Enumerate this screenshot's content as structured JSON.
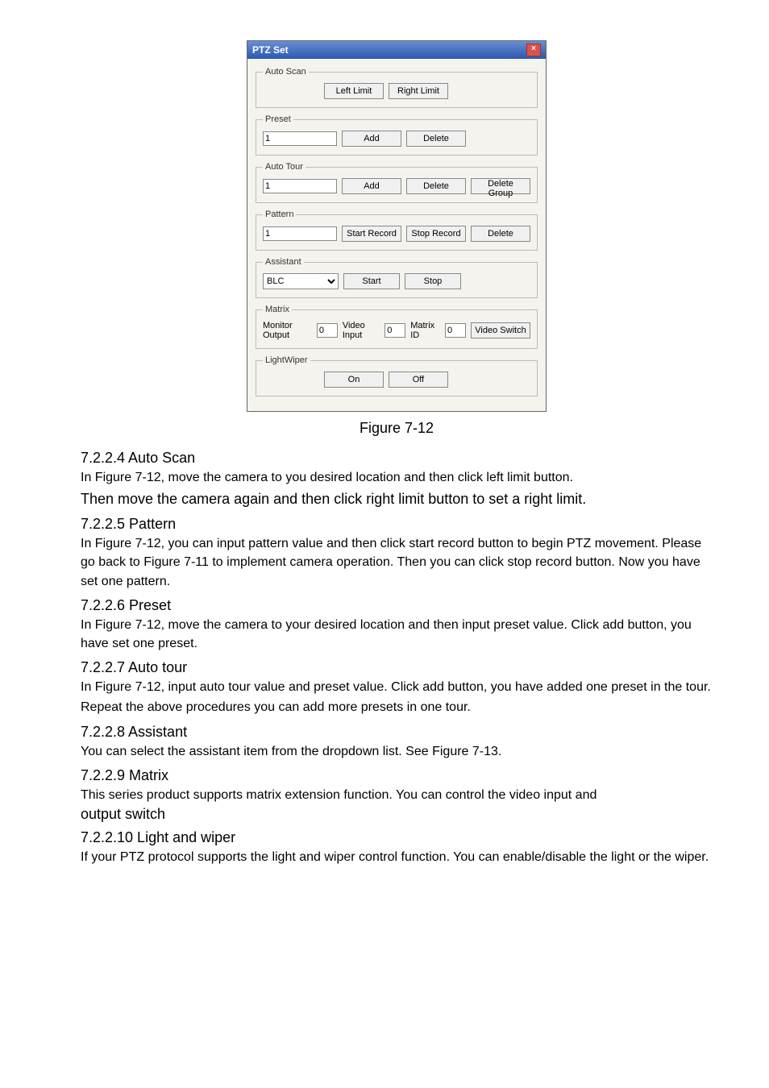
{
  "dialog": {
    "title": "PTZ Set",
    "close_icon": "×",
    "groups": {
      "auto_scan": {
        "legend": "Auto Scan",
        "left_limit": "Left Limit",
        "right_limit": "Right Limit"
      },
      "preset": {
        "legend": "Preset",
        "value": "1",
        "add": "Add",
        "delete": "Delete"
      },
      "auto_tour": {
        "legend": "Auto Tour",
        "value": "1",
        "add": "Add",
        "delete": "Delete",
        "delete_group": "Delete Group"
      },
      "pattern": {
        "legend": "Pattern",
        "value": "1",
        "start_record": "Start Record",
        "stop_record": "Stop Record",
        "delete": "Delete"
      },
      "assistant": {
        "legend": "Assistant",
        "selected": "BLC",
        "start": "Start",
        "stop": "Stop"
      },
      "matrix": {
        "legend": "Matrix",
        "monitor_output_label": "Monitor Output",
        "monitor_output_value": "0",
        "video_input_label": "Video Input",
        "video_input_value": "0",
        "matrix_id_label": "Matrix ID",
        "matrix_id_value": "0",
        "video_switch": "Video Switch"
      },
      "light_wiper": {
        "legend": "LightWiper",
        "on": "On",
        "off": "Off"
      }
    }
  },
  "caption": "Figure 7-12",
  "sections": {
    "s1_h": "7.2.2.4  Auto Scan",
    "s1_p1": "In Figure 7-12, move the camera to you desired location and then click left limit button.",
    "s1_p2": "Then move the camera again and then click right limit button to set a right limit.",
    "s2_h": "7.2.2.5  Pattern",
    "s2_p1": "In Figure 7-12, you can input pattern value and then click start record button to begin PTZ movement. Please go back to Figure 7-11 to implement camera operation. Then you can click stop record button. Now you have set one pattern.",
    "s3_h": "7.2.2.6  Preset",
    "s3_p1": "In Figure 7-12, move the camera to your desired location and then input preset value. Click add button, you have set one preset.",
    "s4_h": "7.2.2.7  Auto tour",
    "s4_p1": "In Figure 7-12, input auto tour value and preset value. Click add button, you have added one preset in the tour.",
    "s4_p2": "Repeat the above procedures you can add more presets in one tour.",
    "s5_h": "7.2.2.8  Assistant",
    "s5_p1": "You can select the assistant item from the dropdown list. See Figure 7-13.",
    "s6_h": "7.2.2.9  Matrix",
    "s6_p1": "This series product supports matrix extension function. You can control the video input and",
    "s6_p2": "output switch",
    "s7_h": "7.2.2.10   Light and wiper",
    "s7_p1": "If your PTZ protocol supports the light and wiper control function. You can enable/disable the light or the wiper."
  }
}
